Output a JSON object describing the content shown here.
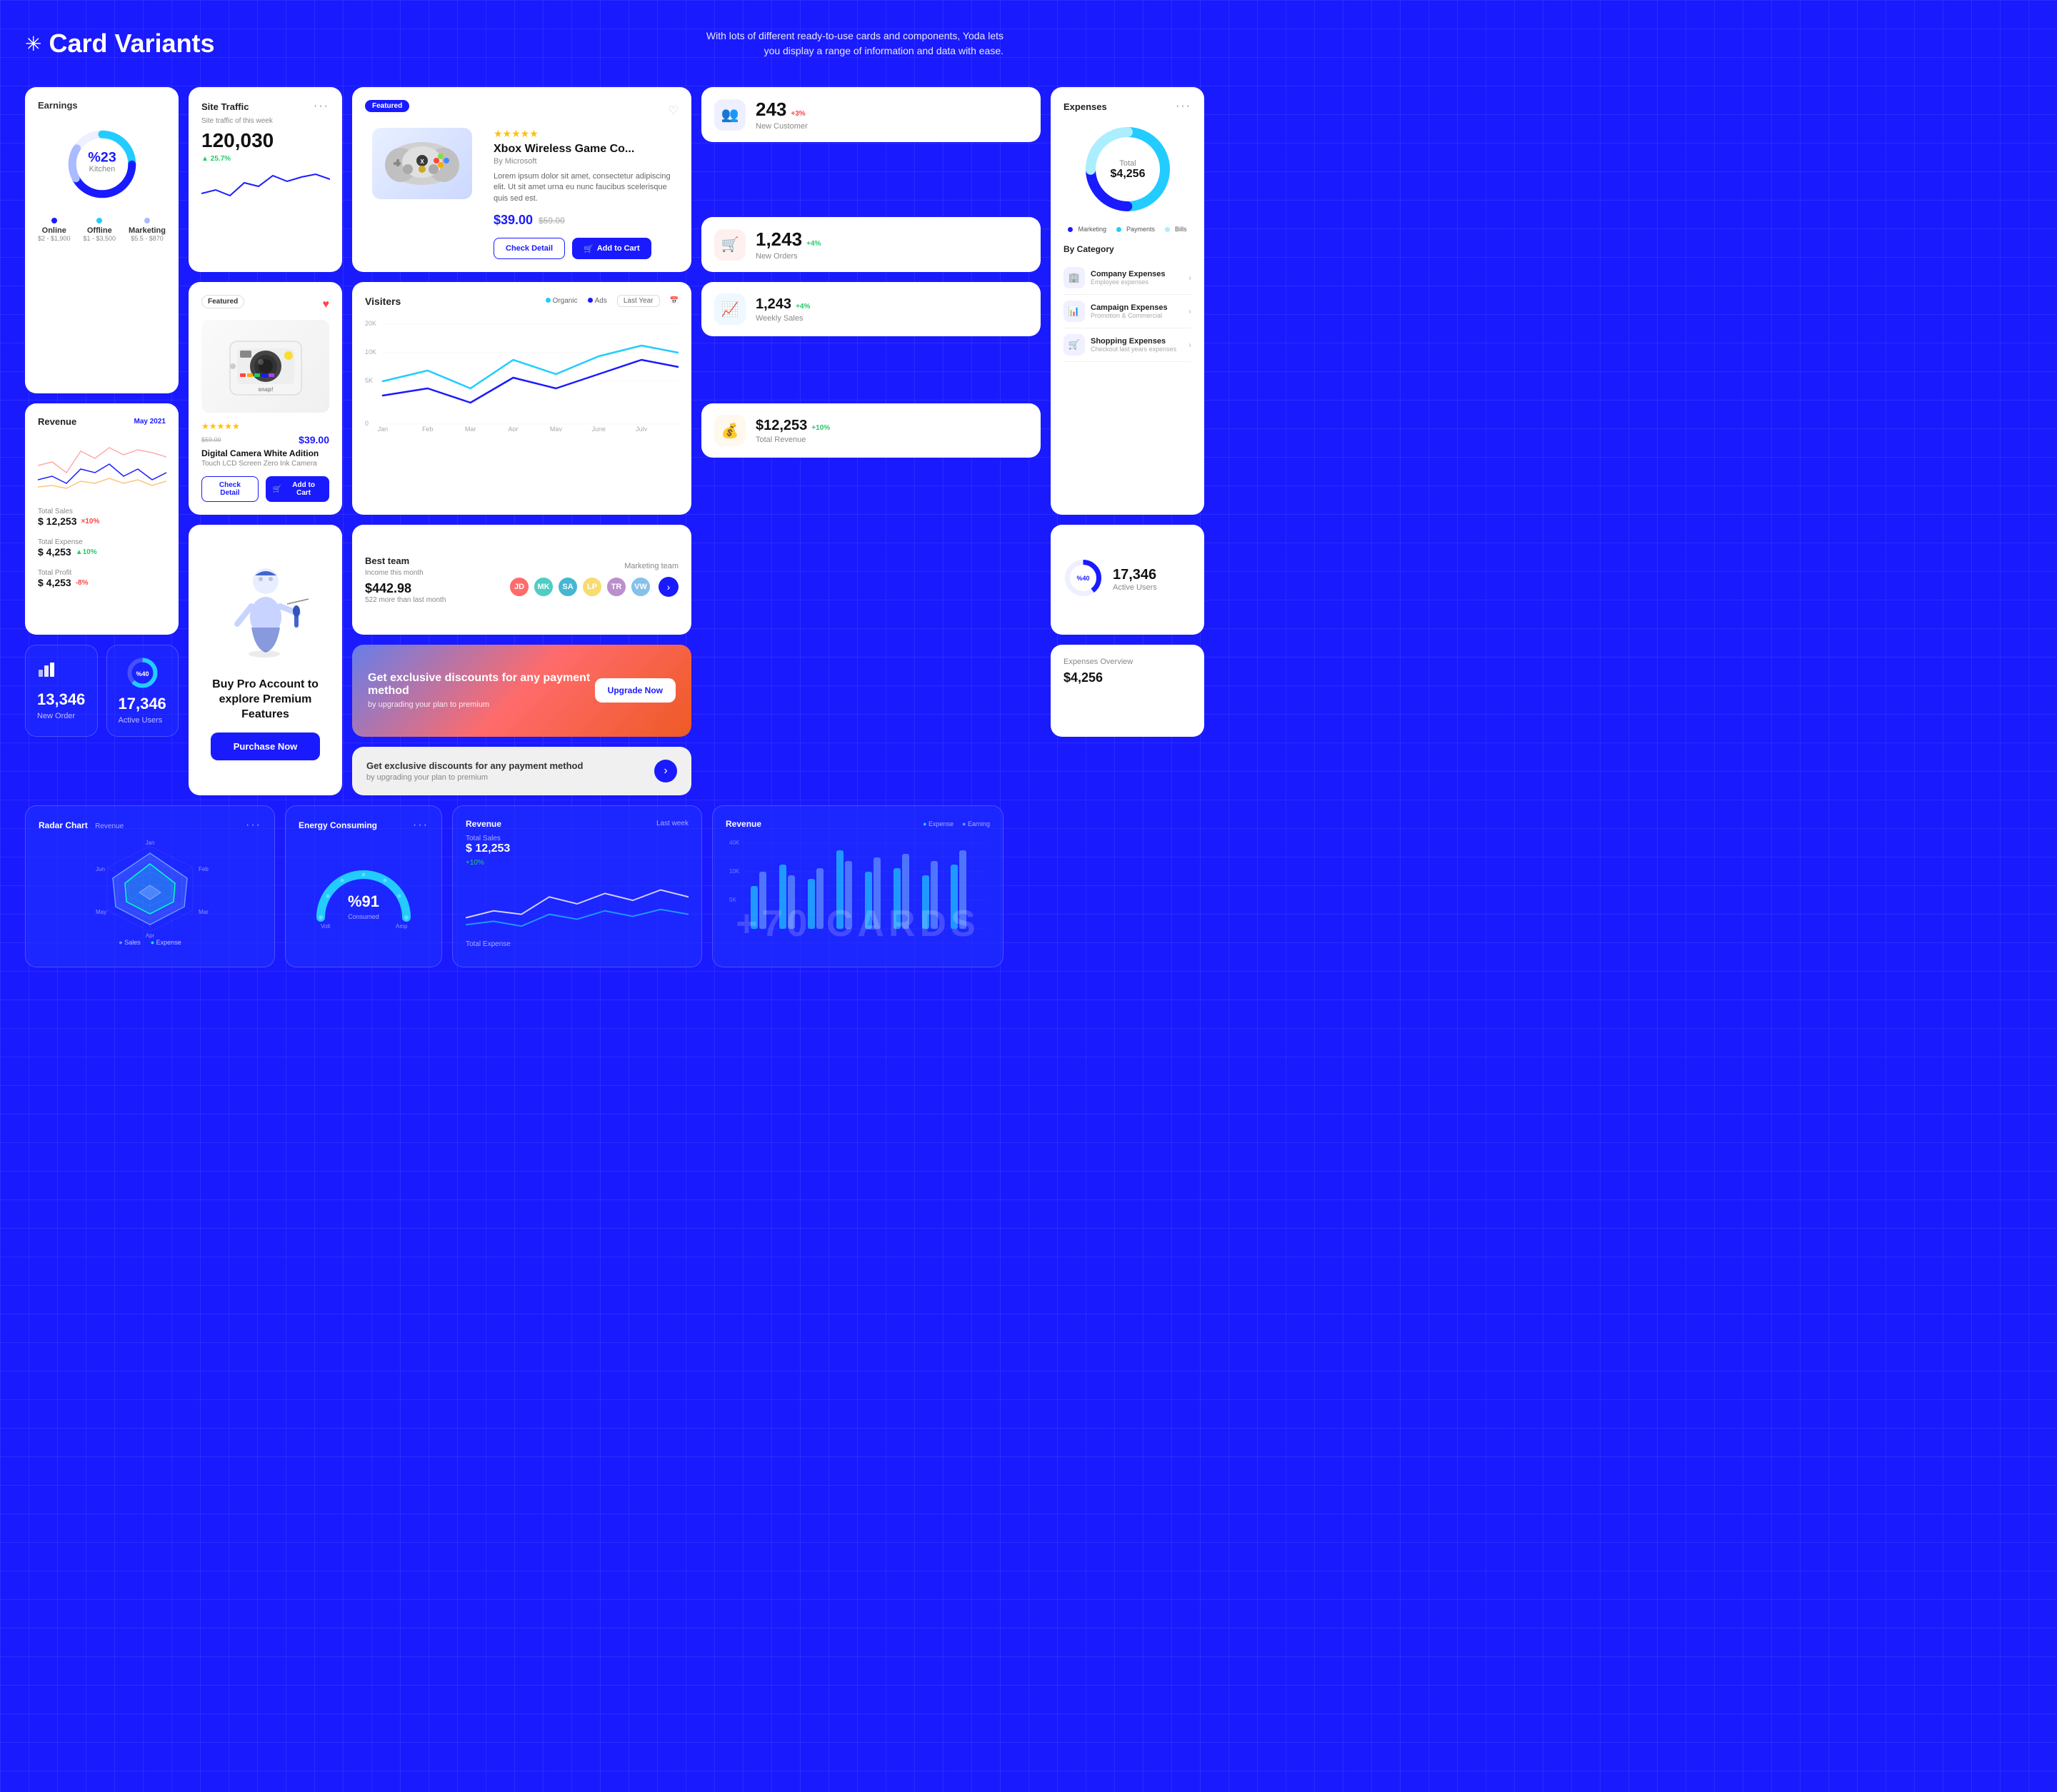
{
  "header": {
    "star": "✳",
    "title": "Card Variants",
    "description": "With lots of different ready-to-use cards and components, Yoda lets you\ndisplay a range of information and data with ease."
  },
  "earnings": {
    "title": "Earnings",
    "percentage": "%23",
    "sublabel": "Kitchen",
    "legend": [
      {
        "label": "Online",
        "range": "$2 - $1,900",
        "color": "#1a1aff"
      },
      {
        "label": "Offline",
        "range": "$1 - $3,500",
        "color": "#22ccff"
      },
      {
        "label": "Marketing",
        "range": "$5.5 - $870",
        "color": "#aabbff"
      }
    ]
  },
  "site_traffic": {
    "title": "Site Traffic",
    "subtitle": "Site traffic of this week",
    "value": "120,030",
    "change": "▲ 25.7%",
    "change_type": "positive"
  },
  "product_xbox": {
    "badge": "Featured",
    "name": "Xbox Wireless Game Co...",
    "brand": "By Microsoft",
    "rating": "★★★★★",
    "description": "Lorem ipsum dolor sit amet, consectetur adipiscing elit. Ut sit amet urna eu nunc faucibus scelerisque quis sed est.",
    "price": "$39.00",
    "price_old": "$59.00",
    "check_detail": "Check Detail",
    "add_to_cart": "Add to Cart"
  },
  "new_customer": {
    "value": "243",
    "change": "+3%",
    "change_type": "negative",
    "label": "New Customer"
  },
  "new_orders": {
    "value": "1,243",
    "change": "+4%",
    "change_type": "positive",
    "label": "New Orders"
  },
  "revenue": {
    "title": "Revenue",
    "period": "May 2021",
    "total_sales_label": "Total Sales",
    "total_sales_value": "$ 12,253",
    "total_sales_change": "×10%",
    "total_expense_label": "Total Expense",
    "total_expense_value": "$ 4,253",
    "total_expense_change": "▲10%",
    "total_profit_label": "Total Profit",
    "total_profit_value": "$ 4,253",
    "total_profit_change": "-8%"
  },
  "product_camera": {
    "badge": "Featured",
    "name": "Digital Camera White Adition",
    "brand": "Touch LCD Screen Zero Ink Camera",
    "rating": "★★★★★",
    "price": "$39.00",
    "price_old": "$59.00",
    "check_detail": "Check Detail",
    "add_to_cart": "Add to Cart"
  },
  "visitors": {
    "title": "Visiters",
    "legend": [
      "Organic",
      "Ads"
    ],
    "last_year": "Last Year",
    "months": [
      "Jan",
      "Feb",
      "Mar",
      "Apr",
      "May",
      "June",
      "July"
    ],
    "y_axis": [
      "20K",
      "10K",
      "5K",
      "0"
    ]
  },
  "expenses": {
    "title": "Expenses",
    "total_label": "Total",
    "total_value": "$4,256",
    "legend": [
      {
        "label": "Marketing",
        "color": "#1a1aff"
      },
      {
        "label": "Payments",
        "color": "#22ccff"
      },
      {
        "label": "Bills",
        "color": "#aaeeff"
      }
    ],
    "by_category": "By Category",
    "categories": [
      {
        "icon": "🏢",
        "name": "Company Expenses",
        "sub": "Employee expenses"
      },
      {
        "icon": "📊",
        "name": "Campaign Expenses",
        "sub": "Promotion & Commercial"
      },
      {
        "icon": "🛒",
        "name": "Shopping Expenses",
        "sub": "Checkout last years expenses"
      }
    ]
  },
  "best_team": {
    "title": "Best team",
    "subtitle": "Income this month",
    "amount": "$442.98",
    "change": "522 more than last month",
    "team_label": "Marketing team"
  },
  "promo_upgrade": {
    "title": "Get exclusive discounts for any payment method",
    "subtitle": "by upgrading your plan to premium",
    "btn_label": "Upgrade Now"
  },
  "promo_grey": {
    "title": "Get exclusive discounts for any payment method",
    "subtitle": "by upgrading your plan to premium"
  },
  "buy_pro": {
    "title": "Buy Pro Account to explore Premium Features",
    "btn_label": "Purchase Now"
  },
  "small_stats": [
    {
      "value": "13,346",
      "label": "New Order",
      "icon": "📊"
    },
    {
      "value": "17,346",
      "label": "Active Users",
      "icon": "📈"
    }
  ],
  "active_users_large": {
    "donut_pct": "40",
    "value": "17,346",
    "label": "Active Users"
  },
  "bottom": {
    "radar_title": "Radar Chart",
    "radar_subtitle": "Revenue",
    "energy_title": "Energy Consuming",
    "energy_pct": "%91",
    "energy_sublabel": "Consumed",
    "energy_unit": "Volt",
    "revenue_mini_title": "Revenue",
    "revenue_mini_period": "Last week",
    "revenue_mini_sales": "$ 12,253",
    "revenue_mini_change": "+10%",
    "revenue_mini_expense": "Total Expense",
    "bar_title": "Revenue",
    "bar_legend_expense": "Expense",
    "bar_legend_earning": "Earning",
    "plus_cards": "+70  CARDS",
    "radar_legend": [
      "Sales",
      "Expense"
    ]
  }
}
